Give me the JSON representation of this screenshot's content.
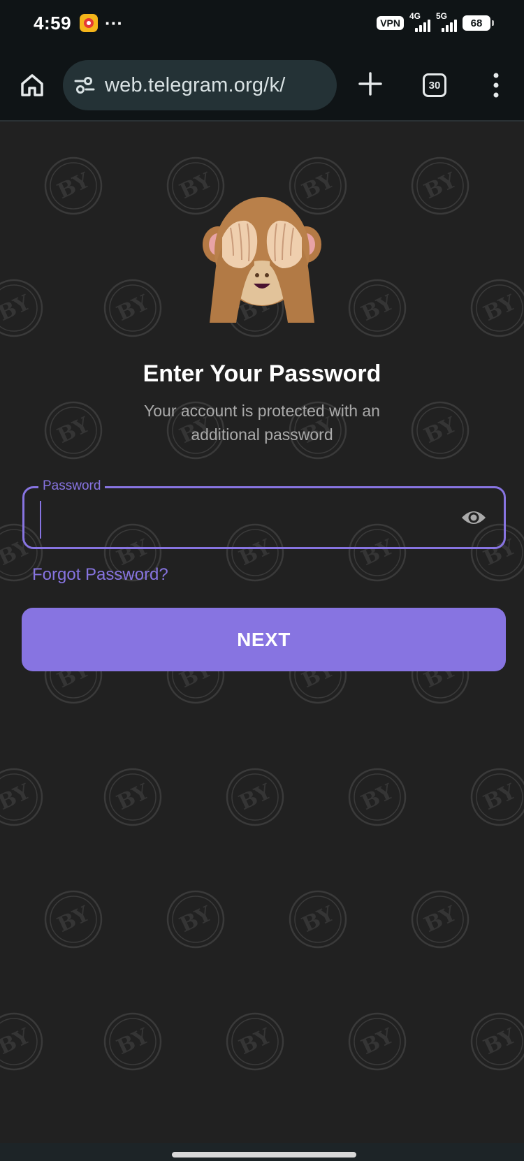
{
  "status_bar": {
    "time": "4:59",
    "more_indicator": "···",
    "vpn": "VPN",
    "network_1": "4G",
    "network_2": "5G",
    "battery": "68"
  },
  "browser": {
    "url": "web.telegram.org/k/",
    "tab_count": "30",
    "icons": [
      "home-icon",
      "site-settings-icon",
      "plus-icon",
      "tabs-icon",
      "more-vert-icon"
    ]
  },
  "login": {
    "title": "Enter Your Password",
    "subtitle": "Your account is protected with an additional password",
    "password_label": "Password",
    "password_value": "",
    "forgot_link": "Forgot Password?",
    "next_button": "NEXT"
  },
  "colors": {
    "accent": "#8774e1",
    "background": "#212121",
    "toolbar": "#0f1416"
  }
}
